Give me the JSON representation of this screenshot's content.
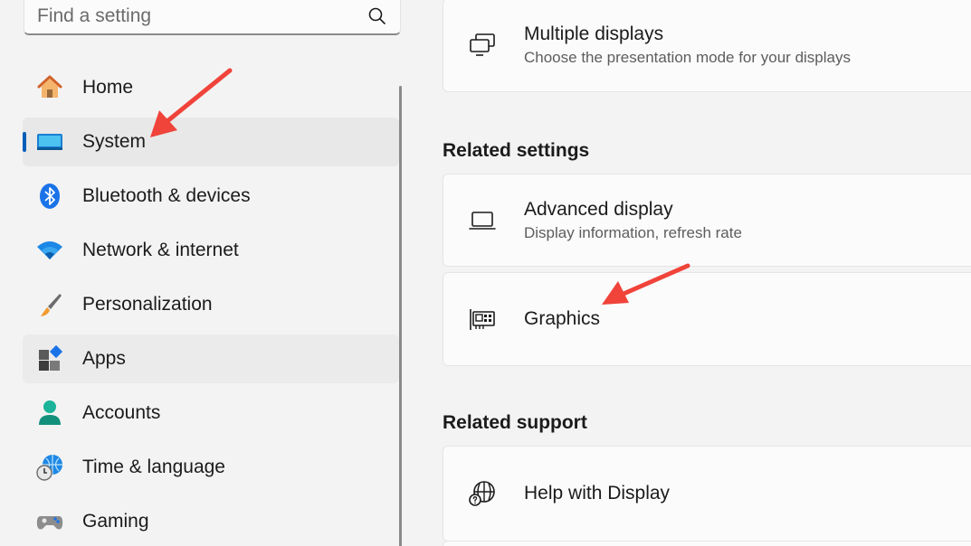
{
  "search": {
    "placeholder": "Find a setting",
    "value": ""
  },
  "nav": {
    "items": [
      {
        "label": "Home",
        "icon": "home-icon"
      },
      {
        "label": "System",
        "icon": "system-icon",
        "selected": true
      },
      {
        "label": "Bluetooth & devices",
        "icon": "bluetooth-icon"
      },
      {
        "label": "Network & internet",
        "icon": "wifi-icon"
      },
      {
        "label": "Personalization",
        "icon": "paintbrush-icon"
      },
      {
        "label": "Apps",
        "icon": "apps-icon"
      },
      {
        "label": "Accounts",
        "icon": "person-icon"
      },
      {
        "label": "Time & language",
        "icon": "globe-clock-icon"
      },
      {
        "label": "Gaming",
        "icon": "gamepad-icon"
      }
    ]
  },
  "main": {
    "multiple_displays": {
      "title": "Multiple displays",
      "subtitle": "Choose the presentation mode for your displays"
    },
    "related_settings": {
      "heading": "Related settings",
      "advanced_display": {
        "title": "Advanced display",
        "subtitle": "Display information, refresh rate"
      },
      "graphics": {
        "title": "Graphics"
      }
    },
    "related_support": {
      "heading": "Related support",
      "help_display": {
        "title": "Help with Display"
      }
    }
  },
  "colors": {
    "accent": "#005fb8",
    "arrow": "#f0433a",
    "selected_bg": "#e8e8e8"
  }
}
